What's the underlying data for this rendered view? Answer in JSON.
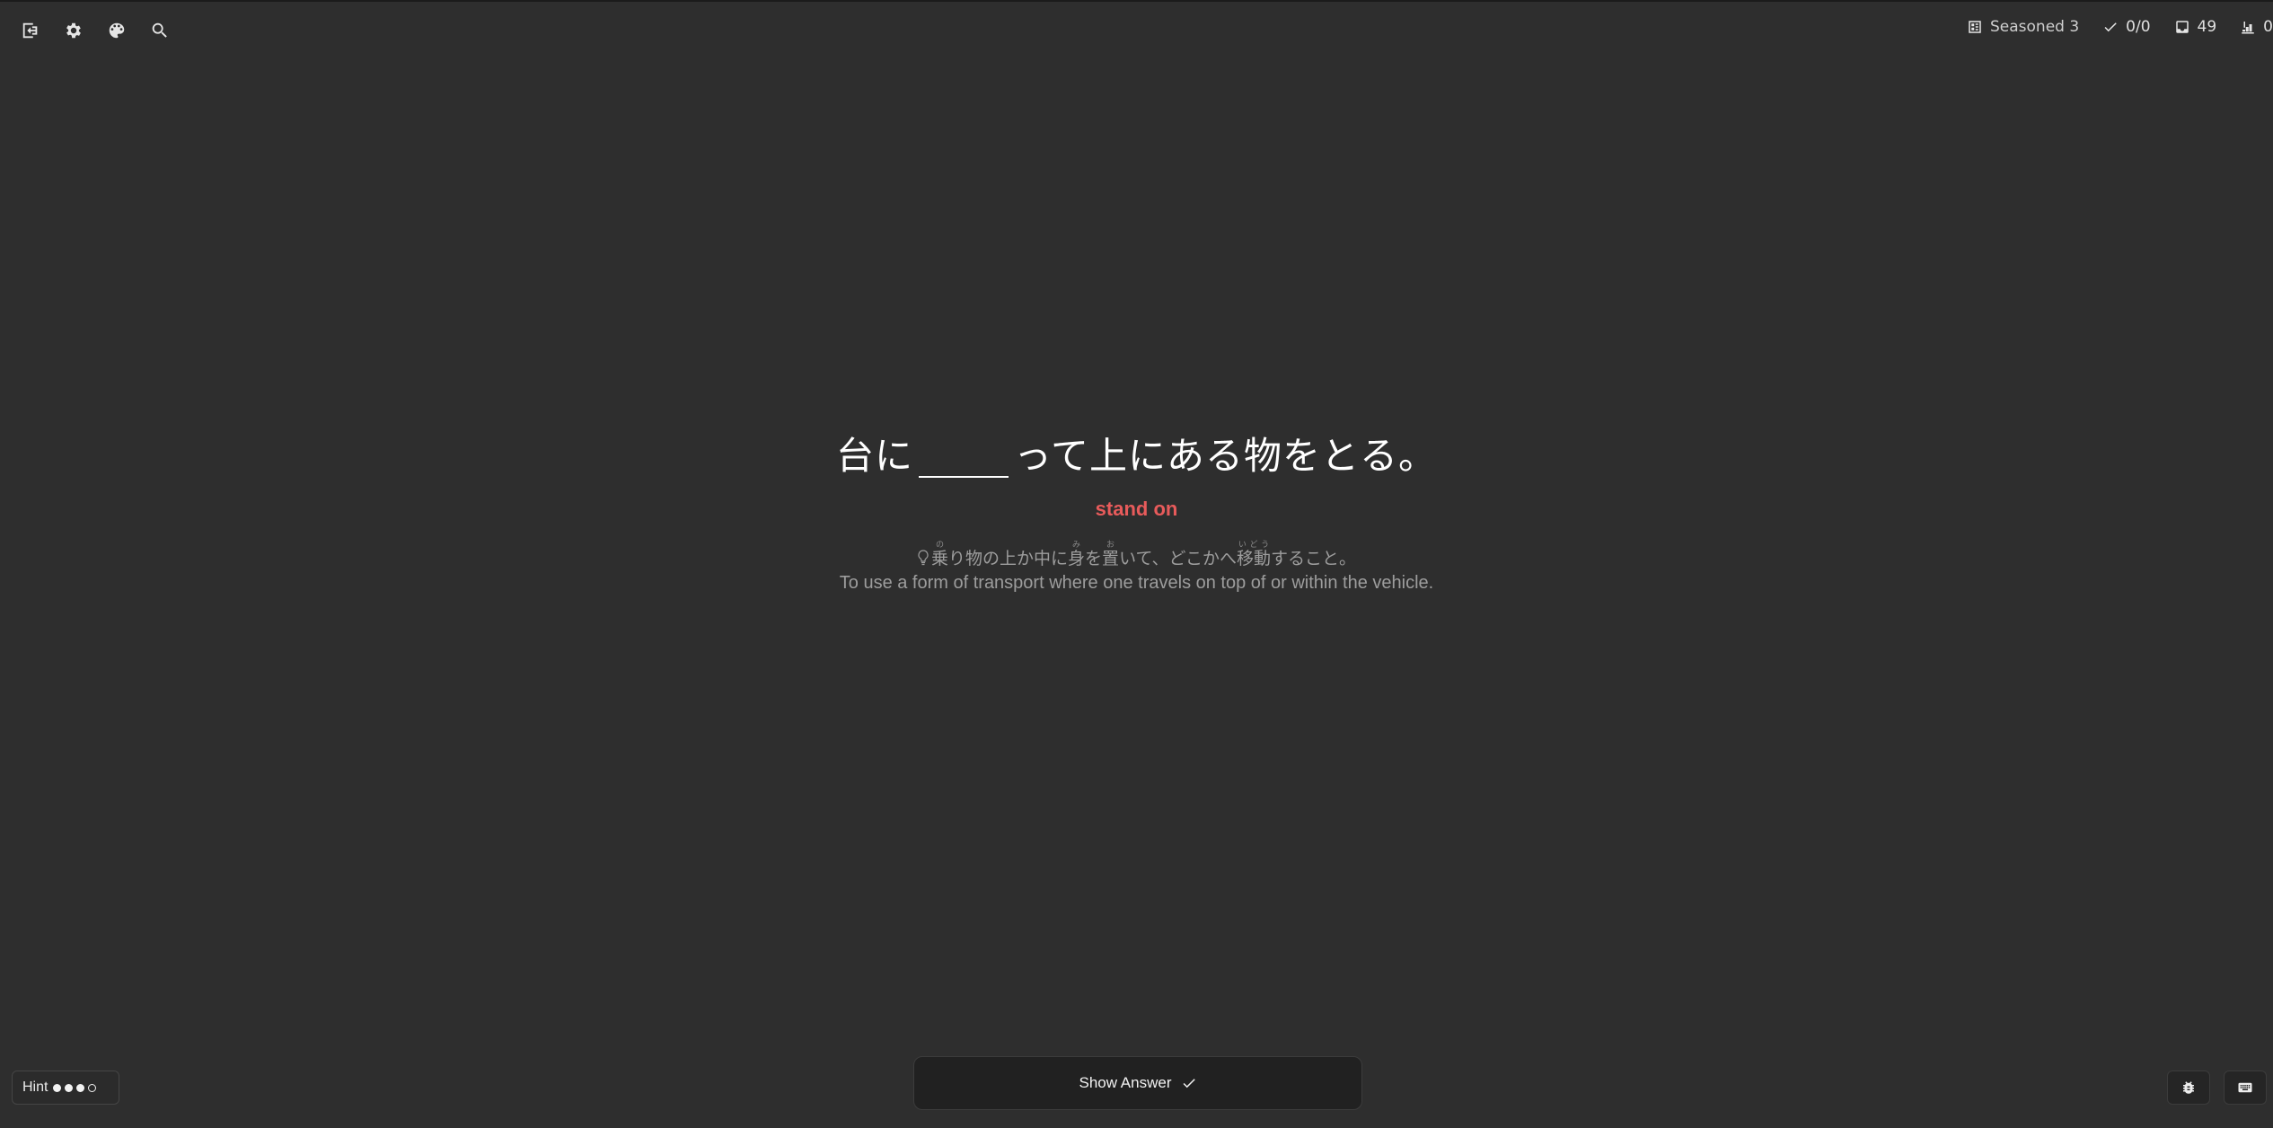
{
  "toolbar": {
    "icons": [
      "exit-icon",
      "gear-icon",
      "palette-icon",
      "search-icon"
    ]
  },
  "status": {
    "level_label": "Seasoned 3",
    "reviews": "0/0",
    "inbox_count": "49",
    "stairs_count": "0"
  },
  "card": {
    "sentence_before": "台に",
    "sentence_after": "って上にある物をとる。",
    "meaning": "stand on",
    "definition_jp": {
      "seg1": "乗",
      "ruby1": "の",
      "seg2": "り物の上か中に",
      "seg3": "身",
      "ruby3": "み",
      "seg4": "を",
      "seg5": "置",
      "ruby5": "お",
      "seg6": "いて、どこかへ",
      "seg7": "移動",
      "ruby7": "いどう",
      "seg8": "すること。"
    },
    "definition_en": "To use a form of transport where one travels on top of or within the vehicle."
  },
  "hint": {
    "label": "Hint",
    "filled": 3,
    "total": 4
  },
  "actions": {
    "show_answer": "Show Answer"
  },
  "colors": {
    "background": "#2e2e2e",
    "meaning": "#e85b5b"
  }
}
